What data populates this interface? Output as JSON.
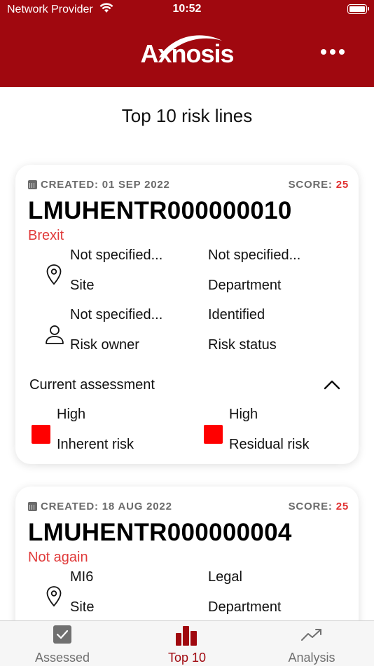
{
  "status_bar": {
    "carrier": "Network Provider",
    "time": "10:52"
  },
  "header": {
    "logo_text": "Axnosis",
    "menu_icon": "more-horizontal-icon"
  },
  "page": {
    "title": "Top 10 risk lines"
  },
  "cards": [
    {
      "created": "CREATED: 01 SEP 2022",
      "score_label": "SCORE:",
      "score_value": "25",
      "ref": "LMUHENTR000000010",
      "subtitle": "Brexit",
      "site_value": "Not specified...",
      "site_label": "Site",
      "department_value": "Not specified...",
      "department_label": "Department",
      "owner_value": "Not specified...",
      "owner_label": "Risk owner",
      "status_value": "Identified",
      "status_label": "Risk status",
      "assessment_title": "Current assessment",
      "inherent_value": "High",
      "inherent_label": "Inherent risk",
      "residual_value": "High",
      "residual_label": "Residual risk",
      "risk_color": "#ff0000"
    },
    {
      "created": "CREATED: 18 AUG 2022",
      "score_label": "SCORE:",
      "score_value": "25",
      "ref": "LMUHENTR000000004",
      "subtitle": "Not again",
      "site_value": "MI6",
      "site_label": "Site",
      "department_value": "Legal",
      "department_label": "Department"
    }
  ],
  "tabs": [
    {
      "label": "Assessed",
      "icon": "checkbox-icon",
      "active": false
    },
    {
      "label": "Top 10",
      "icon": "bar-chart-icon",
      "active": true
    },
    {
      "label": "Analysis",
      "icon": "trend-up-icon",
      "active": false
    }
  ],
  "colors": {
    "brand": "#a0080f",
    "accent_red": "#e03a3a",
    "tab_inactive": "#707070"
  }
}
